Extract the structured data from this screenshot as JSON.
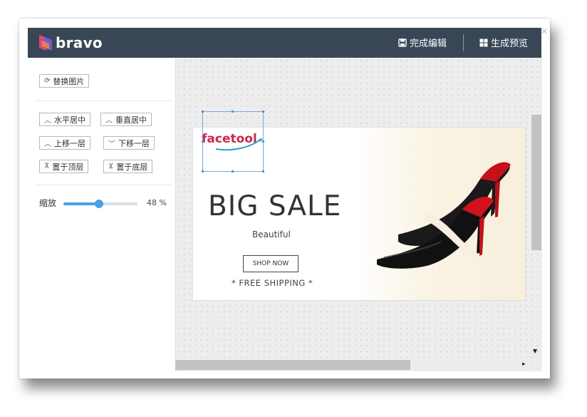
{
  "header": {
    "logo_text": "bravo",
    "finish_edit_label": "完成编辑",
    "preview_label": "生成预览"
  },
  "left_panel": {
    "replace_image_label": "替换图片",
    "align_horizontal_label": "水平居中",
    "align_vertical_label": "垂直居中",
    "move_up_label": "上移一层",
    "move_down_label": "下移一层",
    "bring_to_top_label": "置于顶层",
    "send_to_bottom_label": "置于底层",
    "zoom_label": "缩放",
    "zoom_value": "48 %",
    "zoom_percent": 48
  },
  "banner": {
    "logo_text": "facetool",
    "title": "BIG SALE",
    "subtitle": "Beautiful",
    "button_label": "SHOP NOW",
    "shipping_text": "* FREE SHIPPING *"
  },
  "colors": {
    "topbar": "#384656",
    "accent": "#4aa1e8",
    "brand_logo": "#c62a4b"
  }
}
